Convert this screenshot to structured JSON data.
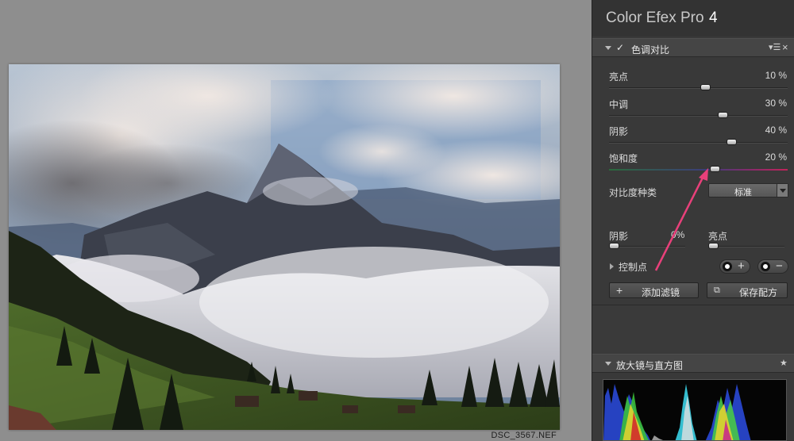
{
  "canvas": {
    "filename": "DSC_3567.NEF"
  },
  "panel": {
    "app_name": "Color Efex Pro",
    "app_version": "4",
    "filter": {
      "title": "色调对比",
      "menu_icon": "▾☰",
      "close_icon": "×",
      "sliders": [
        {
          "label": "亮点",
          "value_text": "10 %",
          "value": 10
        },
        {
          "label": "中调",
          "value_text": "30 %",
          "value": 30
        },
        {
          "label": "阴影",
          "value_text": "40 %",
          "value": 40
        },
        {
          "label": "饱和度",
          "value_text": "20 %",
          "value": 20
        }
      ],
      "contrast_type_label": "对比度种类",
      "contrast_type_value": "标准",
      "mini_sliders": [
        {
          "label": "阴影",
          "value_text": "0%",
          "value": 0
        },
        {
          "label": "亮点",
          "value_text": "",
          "value": 0
        }
      ],
      "control_points_label": "控制点",
      "add_symbol": "+",
      "remove_symbol": "−"
    },
    "buttons": {
      "add_filter": "添加滤镜",
      "add_filter_icon": "+",
      "save_recipe": "保存配方"
    },
    "loupe": {
      "title": "放大镜与直方图",
      "pin_icon": "pin-icon"
    }
  },
  "colors": {
    "panel_bg": "#393939",
    "canvas_bg": "#8e8e8e",
    "annotation_arrow": "#e8407a"
  }
}
